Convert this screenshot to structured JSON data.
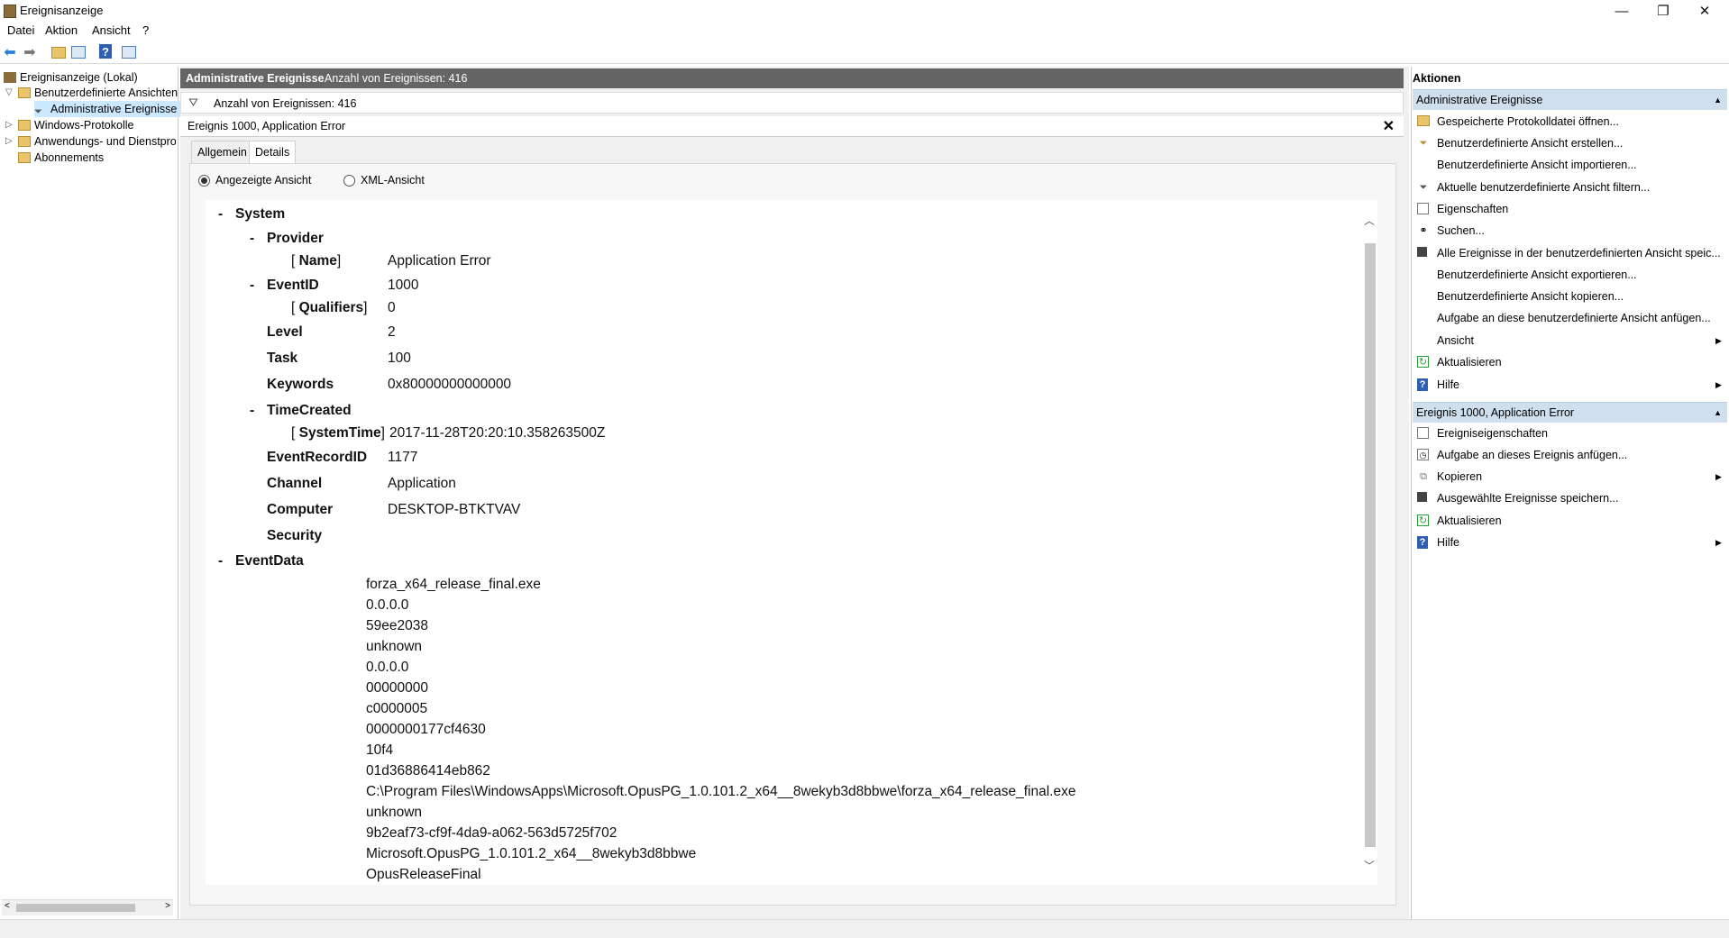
{
  "window": {
    "title": "Ereignisanzeige",
    "controls": [
      "—",
      "❐",
      "✕"
    ]
  },
  "menu": [
    "Datei",
    "Aktion",
    "Ansicht",
    "?"
  ],
  "tree": {
    "items": [
      {
        "label": "Ereignisanzeige (Lokal)"
      },
      {
        "label": "Benutzerdefinierte Ansichten"
      },
      {
        "label": "Administrative Ereignisse"
      },
      {
        "label": "Windows-Protokolle"
      },
      {
        "label": "Anwendungs- und Dienstprotokolle"
      },
      {
        "label": "Abonnements"
      }
    ]
  },
  "center": {
    "header_title": "Administrative Ereignisse",
    "header_count": "Anzahl von Ereignissen: 416",
    "filter_text": "Anzahl von Ereignissen: 416",
    "detail_title": "Ereignis 1000, Application Error",
    "tabs": [
      "Allgemein",
      "Details"
    ],
    "radio_friendly": "Angezeigte Ansicht",
    "radio_xml": "XML-Ansicht"
  },
  "event": {
    "system": "System",
    "provider": "Provider",
    "name_key": "Name",
    "name_val": "Application Error",
    "eventid_key": "EventID",
    "eventid_val": "1000",
    "qualifiers_key": "Qualifiers",
    "qualifiers_val": "0",
    "level_key": "Level",
    "level_val": "2",
    "task_key": "Task",
    "task_val": "100",
    "keywords_key": "Keywords",
    "keywords_val": "0x80000000000000",
    "timecreated_key": "TimeCreated",
    "systemtime_key": "SystemTime",
    "systemtime_val": "2017-11-28T20:20:10.358263500Z",
    "recordid_key": "EventRecordID",
    "recordid_val": "1177",
    "channel_key": "Channel",
    "channel_val": "Application",
    "computer_key": "Computer",
    "computer_val": "DESKTOP-BTKTVAV",
    "security_key": "Security",
    "eventdata_key": "EventData",
    "eventdata": [
      "forza_x64_release_final.exe",
      "0.0.0.0",
      "59ee2038",
      "unknown",
      "0.0.0.0",
      "00000000",
      "c0000005",
      "0000000177cf4630",
      "10f4",
      "01d36886414eb862",
      "C:\\Program Files\\WindowsApps\\Microsoft.OpusPG_1.0.101.2_x64__8wekyb3d8bbwe\\forza_x64_release_final.exe",
      "unknown",
      "9b2eaf73-cf9f-4da9-a062-563d5725f702",
      "Microsoft.OpusPG_1.0.101.2_x64__8wekyb3d8bbwe",
      "OpusReleaseFinal"
    ]
  },
  "actions": {
    "title": "Aktionen",
    "section1": "Administrative Ereignisse",
    "items1": [
      "Gespeicherte Protokolldatei öffnen...",
      "Benutzerdefinierte Ansicht erstellen...",
      "Benutzerdefinierte Ansicht importieren...",
      "Aktuelle benutzerdefinierte Ansicht filtern...",
      "Eigenschaften",
      "Suchen...",
      "Alle Ereignisse in der benutzerdefinierten Ansicht speic...",
      "Benutzerdefinierte Ansicht exportieren...",
      "Benutzerdefinierte Ansicht kopieren...",
      "Aufgabe an diese benutzerdefinierte Ansicht anfügen...",
      "Ansicht",
      "Aktualisieren",
      "Hilfe"
    ],
    "section2": "Ereignis 1000, Application Error",
    "items2": [
      "Ereigniseigenschaften",
      "Aufgabe an dieses Ereignis anfügen...",
      "Kopieren",
      "Ausgewählte Ereignisse speichern...",
      "Aktualisieren",
      "Hilfe"
    ]
  },
  "colors": {
    "header_bg": "#656565",
    "section_bg": "#cfdfee",
    "selection_bg": "#cce8ff"
  }
}
